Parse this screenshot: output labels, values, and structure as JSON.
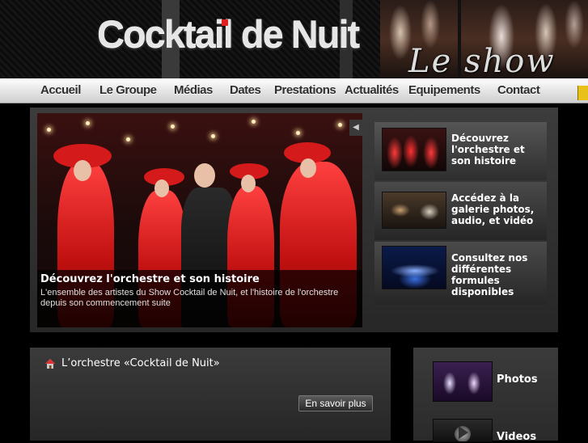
{
  "header": {
    "logo_text": "Cocktail de Nuit",
    "tagline": "Le show"
  },
  "nav": {
    "items": [
      {
        "label": "Accueil"
      },
      {
        "label": "Le Groupe"
      },
      {
        "label": "Médias"
      },
      {
        "label": "Dates"
      },
      {
        "label": "Prestations"
      },
      {
        "label": "Actualités"
      },
      {
        "label": "Equipements"
      },
      {
        "label": "Contact"
      }
    ]
  },
  "slider": {
    "caption_title": "Découvrez l'orchestre et son histoire",
    "caption_text": "L'ensemble des artistes du Show Cocktail de Nuit, et l'histoire de l'orchestre depuis son commencement suite",
    "prev_icon": "triangle-left-icon",
    "thumbs": [
      {
        "text": "Découvrez l'orchestre et son histoire"
      },
      {
        "text": "Accédez à la galerie photos, audio, et vidéo"
      },
      {
        "text": "Consultez nos différentes formules disponibles"
      }
    ]
  },
  "orchestre": {
    "title": "L’orchestre «Cocktail de Nuit»",
    "icon": "house-icon",
    "button_label": "En savoir plus"
  },
  "media": {
    "items": [
      {
        "label": "Photos"
      },
      {
        "label": "Videos"
      }
    ]
  },
  "colors": {
    "nav_text": "#2f2f2f",
    "panel_bg": "#2c2c2c",
    "accent_red": "#e02020"
  }
}
